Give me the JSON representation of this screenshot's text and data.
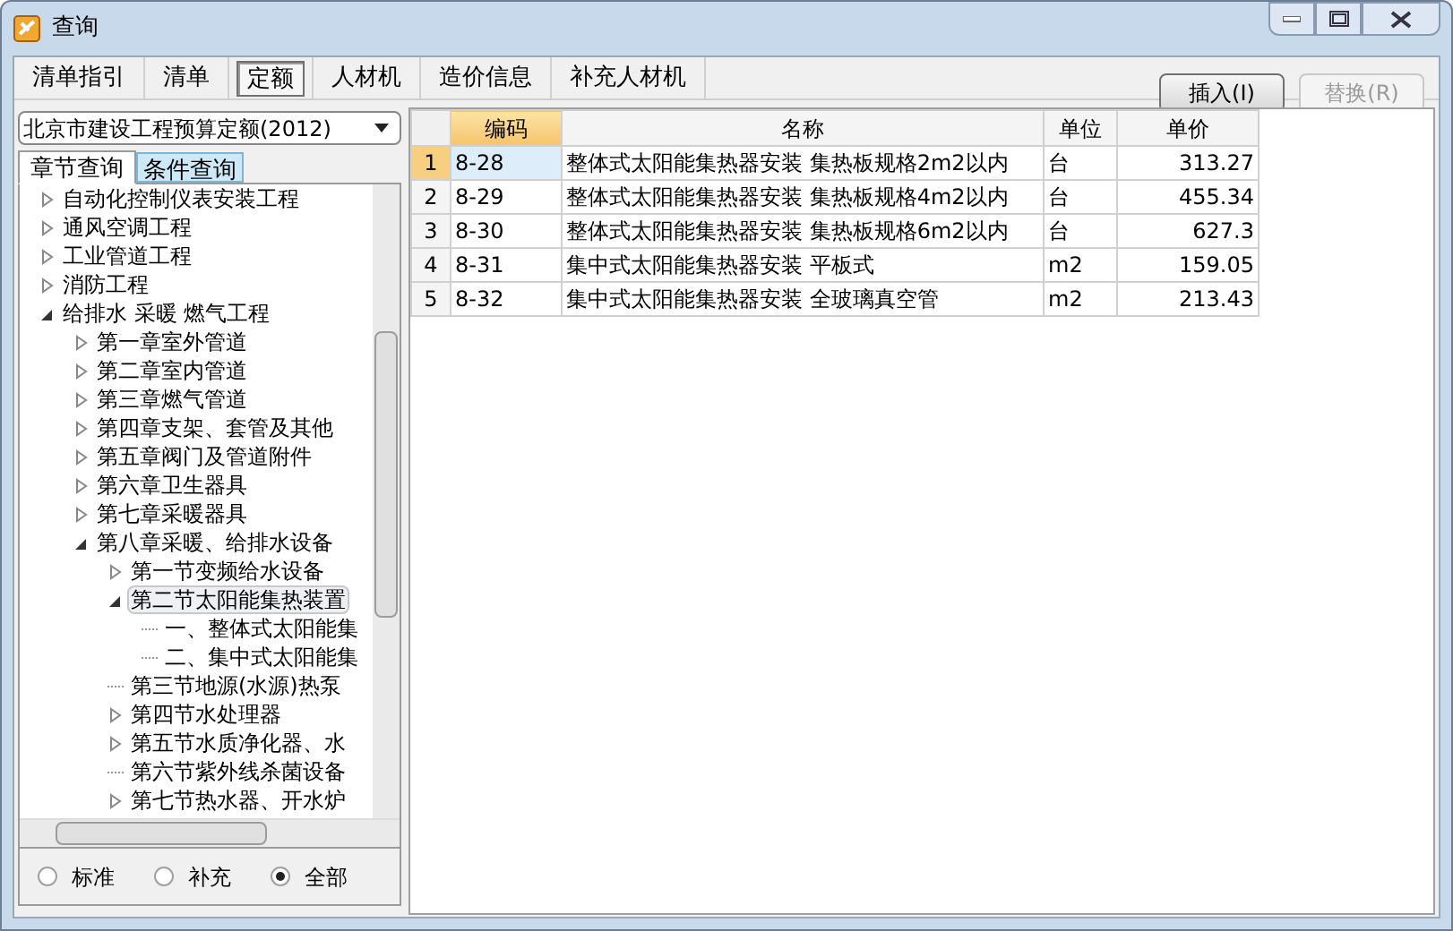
{
  "window": {
    "title": "查询"
  },
  "tabs": [
    {
      "label": "清单指引",
      "selected": false
    },
    {
      "label": "清单",
      "selected": false
    },
    {
      "label": "定额",
      "selected": true
    },
    {
      "label": "人材机",
      "selected": false
    },
    {
      "label": "造价信息",
      "selected": false
    },
    {
      "label": "补充人材机",
      "selected": false
    }
  ],
  "buttons": [
    {
      "label": "插入(I)",
      "disabled": false
    },
    {
      "label": "替换(R)",
      "disabled": true
    }
  ],
  "quota_select": {
    "value": "北京市建设工程预算定额(2012)"
  },
  "query_tabs": [
    {
      "label": "章节查询",
      "selected": true
    },
    {
      "label": "条件查询",
      "selected": false
    }
  ],
  "tree": [
    {
      "label": "自动化控制仪表安装工程",
      "kind": "branch",
      "expanded": false,
      "selected": false
    },
    {
      "label": "通风空调工程",
      "kind": "branch",
      "expanded": false,
      "selected": false
    },
    {
      "label": "工业管道工程",
      "kind": "branch",
      "expanded": false,
      "selected": false
    },
    {
      "label": "消防工程",
      "kind": "branch",
      "expanded": false,
      "selected": false
    },
    {
      "label": "给排水 采暖 燃气工程",
      "kind": "branch",
      "expanded": true,
      "selected": false,
      "children": [
        {
          "label": "第一章室外管道",
          "kind": "branch",
          "expanded": false,
          "selected": false
        },
        {
          "label": "第二章室内管道",
          "kind": "branch",
          "expanded": false,
          "selected": false
        },
        {
          "label": "第三章燃气管道",
          "kind": "branch",
          "expanded": false,
          "selected": false
        },
        {
          "label": "第四章支架、套管及其他",
          "kind": "branch",
          "expanded": false,
          "selected": false
        },
        {
          "label": "第五章阀门及管道附件",
          "kind": "branch",
          "expanded": false,
          "selected": false
        },
        {
          "label": "第六章卫生器具",
          "kind": "branch",
          "expanded": false,
          "selected": false
        },
        {
          "label": "第七章采暖器具",
          "kind": "branch",
          "expanded": false,
          "selected": false
        },
        {
          "label": "第八章采暖、给排水设备",
          "kind": "branch",
          "expanded": true,
          "selected": false,
          "children": [
            {
              "label": "第一节变频给水设备",
              "kind": "branch",
              "expanded": false,
              "selected": false
            },
            {
              "label": "第二节太阳能集热装置",
              "kind": "branch",
              "expanded": true,
              "selected": true,
              "children": [
                {
                  "label": "一、整体式太阳能集",
                  "kind": "leaf",
                  "selected": false
                },
                {
                  "label": "二、集中式太阳能集",
                  "kind": "leaf",
                  "selected": false
                }
              ]
            },
            {
              "label": "第三节地源(水源)热泵",
              "kind": "leaf",
              "selected": false
            },
            {
              "label": "第四节水处理器",
              "kind": "branch",
              "expanded": false,
              "selected": false
            },
            {
              "label": "第五节水质净化器、水",
              "kind": "branch",
              "expanded": false,
              "selected": false
            },
            {
              "label": "第六节紫外线杀菌设备",
              "kind": "leaf",
              "selected": false
            },
            {
              "label": "第七节热水器、开水炉",
              "kind": "branch",
              "expanded": false,
              "selected": false
            }
          ]
        }
      ]
    }
  ],
  "scope_options": [
    {
      "label": "标准",
      "selected": false
    },
    {
      "label": "补充",
      "selected": false
    },
    {
      "label": "全部",
      "selected": true
    }
  ],
  "table": {
    "columns": [
      {
        "label": "编码",
        "highlighted": true
      },
      {
        "label": "名称",
        "highlighted": false
      },
      {
        "label": "单位",
        "highlighted": false
      },
      {
        "label": "单价",
        "highlighted": false
      }
    ],
    "rows": [
      {
        "number": "1",
        "selected": true,
        "cells": [
          "8-28",
          "整体式太阳能集热器安装 集热板规格2m2以内",
          "台",
          "313.27"
        ]
      },
      {
        "number": "2",
        "selected": false,
        "cells": [
          "8-29",
          "整体式太阳能集热器安装 集热板规格4m2以内",
          "台",
          "455.34"
        ]
      },
      {
        "number": "3",
        "selected": false,
        "cells": [
          "8-30",
          "整体式太阳能集热器安装 集热板规格6m2以内",
          "台",
          "627.3"
        ]
      },
      {
        "number": "4",
        "selected": false,
        "cells": [
          "8-31",
          "集中式太阳能集热器安装 平板式",
          "m2",
          "159.05"
        ]
      },
      {
        "number": "5",
        "selected": false,
        "cells": [
          "8-32",
          "集中式太阳能集热器安装 全玻璃真空管",
          "m2",
          "213.43"
        ]
      }
    ]
  }
}
